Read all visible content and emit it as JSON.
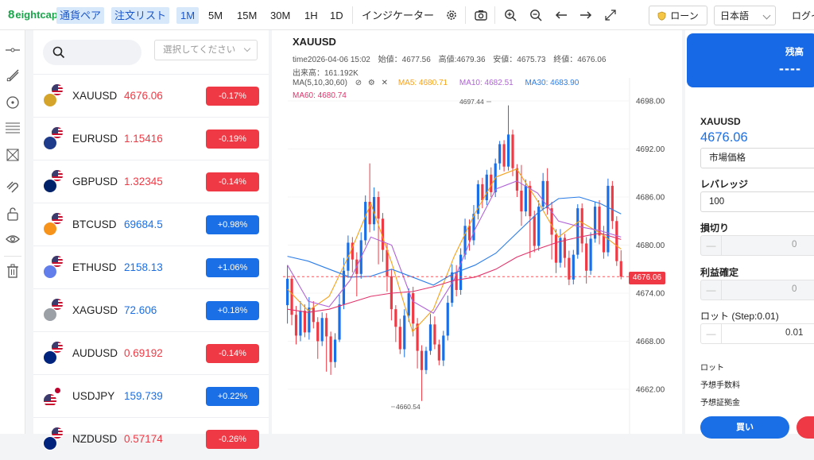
{
  "brand": "eightcap",
  "toolbar": {
    "pairs_tab": "通貨ペア",
    "orders_tab": "注文リスト",
    "timeframes": [
      "1M",
      "5M",
      "15M",
      "30M",
      "1H",
      "1D"
    ],
    "active_timeframe": "1M",
    "indicators": "インジケーター",
    "loan": "ローン",
    "language": "日本語",
    "login": "ログイ"
  },
  "watchlist": {
    "search_placeholder": "",
    "select_placeholder": "選択してください",
    "rows": [
      {
        "symbol": "XAUUSD",
        "price": "4676.06",
        "change": "-0.17%",
        "dir": "down"
      },
      {
        "symbol": "EURUSD",
        "price": "1.15416",
        "change": "-0.19%",
        "dir": "down"
      },
      {
        "symbol": "GBPUSD",
        "price": "1.32345",
        "change": "-0.14%",
        "dir": "down"
      },
      {
        "symbol": "BTCUSD",
        "price": "69684.5",
        "change": "+0.98%",
        "dir": "up"
      },
      {
        "symbol": "ETHUSD",
        "price": "2158.13",
        "change": "+1.06%",
        "dir": "up"
      },
      {
        "symbol": "XAGUSD",
        "price": "72.606",
        "change": "+0.18%",
        "dir": "up"
      },
      {
        "symbol": "AUDUSD",
        "price": "0.69192",
        "change": "-0.14%",
        "dir": "down"
      },
      {
        "symbol": "USDJPY",
        "price": "159.739",
        "change": "+0.22%",
        "dir": "up"
      },
      {
        "symbol": "NZDUSD",
        "price": "0.57174",
        "change": "-0.26%",
        "dir": "down"
      }
    ]
  },
  "chart": {
    "title": "XAUUSD",
    "time": "time2026-04-06 15:02",
    "open": "始値：4677.56",
    "high": "高値:4679.36",
    "low": "安値：4675.73",
    "close": "終値：4676.06",
    "volume": "出来高：161.192K",
    "ma_label": "MA(5,10,30,60)",
    "ma5": "MA5: 4680.71",
    "ma10": "MA10: 4682.51",
    "ma30": "MA30: 4683.90",
    "ma60": "MA60: 4680.74",
    "y_ticks": [
      "4698.00",
      "4692.00",
      "4686.00",
      "4680.00",
      "4674.00",
      "4668.00",
      "4662.00"
    ],
    "current_price": "4676.06",
    "max_label": "4697.44",
    "min_label": "4660.54",
    "colors": {
      "up": "#1a6fe6",
      "down": "#ef3a45",
      "ma5": "#f5a21b",
      "ma10": "#b063d6",
      "ma30": "#2b7de9",
      "ma60": "#e0336b"
    }
  },
  "chart_data": {
    "type": "line",
    "title": "XAUUSD",
    "ylim": [
      4660,
      4700
    ],
    "series": [
      {
        "name": "MA5",
        "values": [
          4674.5,
          4671.8,
          4673.6,
          4679.0,
          4685.2,
          4677.8,
          4669.2,
          4672.0,
          4678.6,
          4684.0,
          4688.5,
          4689.5,
          4685.5,
          4681.0,
          4683.0,
          4681.5,
          4679.5
        ]
      },
      {
        "name": "MA10",
        "values": [
          4677.5,
          4673.0,
          4672.3,
          4675.6,
          4681.0,
          4680.0,
          4673.0,
          4671.5,
          4675.7,
          4682.0,
          4687.0,
          4688.0,
          4686.5,
          4683.0,
          4682.3,
          4681.8,
          4681.0
        ]
      },
      {
        "name": "MA30",
        "values": [
          4678.6,
          4678.0,
          4677.0,
          4676.0,
          4676.1,
          4677.0,
          4676.0,
          4675.0,
          4676.5,
          4677.5,
          4679.0,
          4681.5,
          4684.0,
          4685.8,
          4686.0,
          4685.2,
          4683.9
        ]
      },
      {
        "name": "MA60",
        "values": [
          4672.0,
          4671.6,
          4672.0,
          4672.8,
          4673.6,
          4674.0,
          4674.2,
          4674.8,
          4675.6,
          4676.0,
          4677.0,
          4678.5,
          4679.5,
          4680.4,
          4681.0,
          4681.5,
          4680.7
        ]
      }
    ]
  }
}
